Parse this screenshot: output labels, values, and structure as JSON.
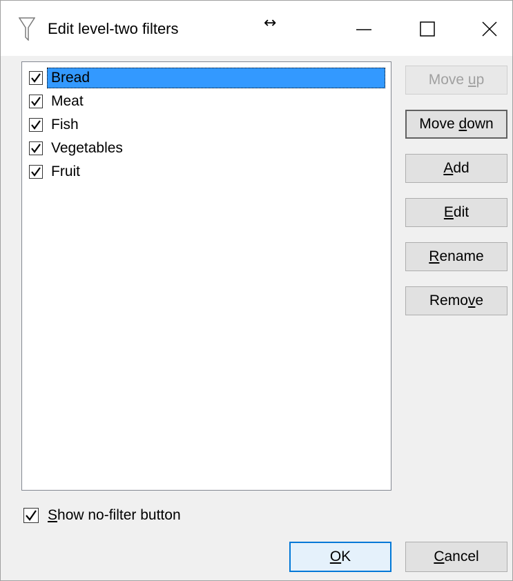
{
  "window": {
    "title": "Edit level-two filters",
    "title_icon": "funnel-icon",
    "resize_icon": "↔",
    "controls": {
      "minimize": "minimize-icon",
      "maximize": "maximize-icon",
      "close": "close-icon"
    }
  },
  "list": {
    "items": [
      {
        "label": "Bread",
        "checked": true,
        "selected": true
      },
      {
        "label": "Meat",
        "checked": true,
        "selected": false
      },
      {
        "label": "Fish",
        "checked": true,
        "selected": false
      },
      {
        "label": "Vegetables",
        "checked": true,
        "selected": false
      },
      {
        "label": "Fruit",
        "checked": true,
        "selected": false
      }
    ]
  },
  "side_buttons": {
    "move_up": {
      "pre": "Move ",
      "mnemonic": "u",
      "post": "p",
      "enabled": false
    },
    "move_down": {
      "pre": "Move ",
      "mnemonic": "d",
      "post": "own",
      "enabled": true
    },
    "add": {
      "pre": "",
      "mnemonic": "A",
      "post": "dd",
      "enabled": true
    },
    "edit": {
      "pre": "",
      "mnemonic": "E",
      "post": "dit",
      "enabled": true
    },
    "rename": {
      "pre": "",
      "mnemonic": "R",
      "post": "ename",
      "enabled": true
    },
    "remove": {
      "pre": "Remo",
      "mnemonic": "v",
      "post": "e",
      "enabled": true
    }
  },
  "footer": {
    "show_no_filter": {
      "pre": "",
      "mnemonic": "S",
      "post": "how no-filter button",
      "checked": true
    },
    "ok": {
      "pre": "",
      "mnemonic": "O",
      "post": "K"
    },
    "cancel": {
      "pre": "",
      "mnemonic": "C",
      "post": "ancel"
    }
  },
  "colors": {
    "selection": "#3399ff",
    "default_button_border": "#0078d7",
    "button_face": "#e1e1e1",
    "dialog_background": "#f0f0f0"
  }
}
